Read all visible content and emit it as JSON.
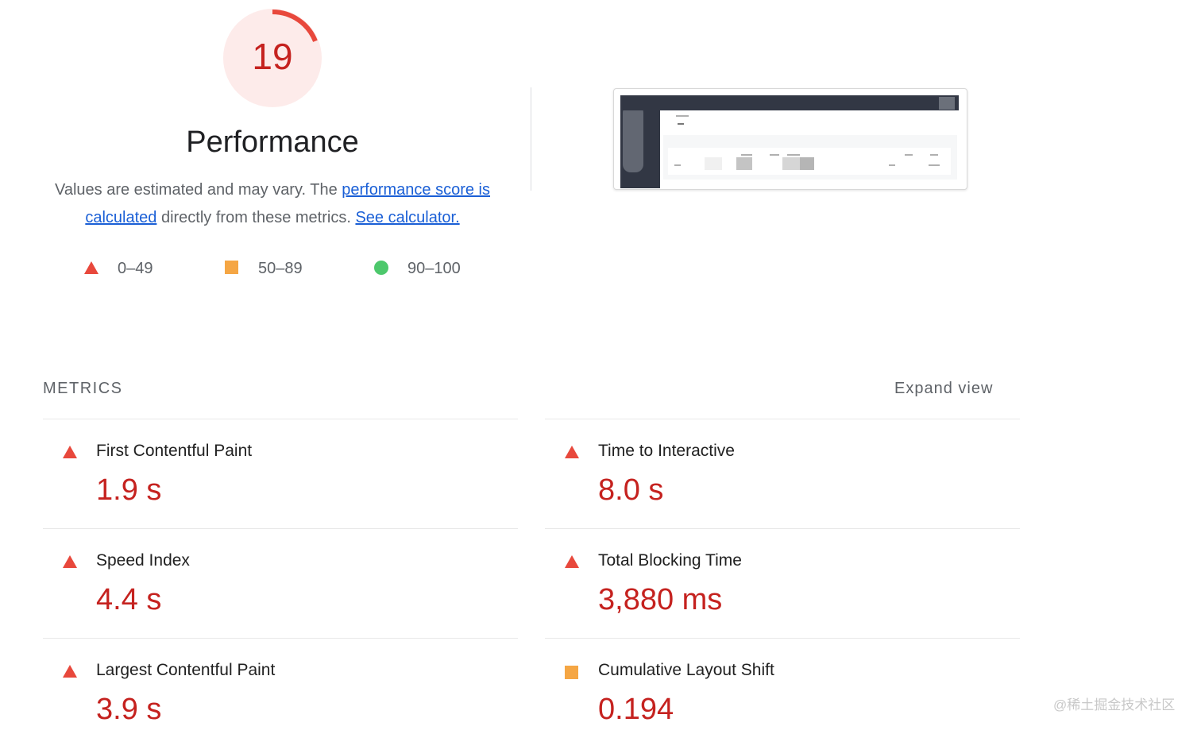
{
  "score": {
    "value": "19",
    "fraction": 0.19,
    "color": "#e8483c",
    "background": "#fdebea"
  },
  "category": {
    "title": "Performance"
  },
  "description": {
    "text_1": "Values are estimated and may vary. The ",
    "link_1": "performance score is calculated",
    "text_2": " directly from these metrics. ",
    "link_2": "See calculator."
  },
  "legend": [
    {
      "range": "0–49",
      "shape": "triangle-icon",
      "color": "#e8483c"
    },
    {
      "range": "50–89",
      "shape": "square-icon",
      "color": "#f5a644"
    },
    {
      "range": "90–100",
      "shape": "circle-icon",
      "color": "#4dc86c"
    }
  ],
  "metrics_section": {
    "title": "METRICS",
    "expand_label": "Expand view"
  },
  "metrics": [
    {
      "label": "First Contentful Paint",
      "value": "1.9 s",
      "rating": "triangle-icon"
    },
    {
      "label": "Time to Interactive",
      "value": "8.0 s",
      "rating": "triangle-icon"
    },
    {
      "label": "Speed Index",
      "value": "4.4 s",
      "rating": "triangle-icon"
    },
    {
      "label": "Total Blocking Time",
      "value": "3,880 ms",
      "rating": "triangle-icon"
    },
    {
      "label": "Largest Contentful Paint",
      "value": "3.9 s",
      "rating": "triangle-icon"
    },
    {
      "label": "Cumulative Layout Shift",
      "value": "0.194",
      "rating": "square-icon"
    }
  ],
  "watermark": "@稀土掘金技术社区"
}
